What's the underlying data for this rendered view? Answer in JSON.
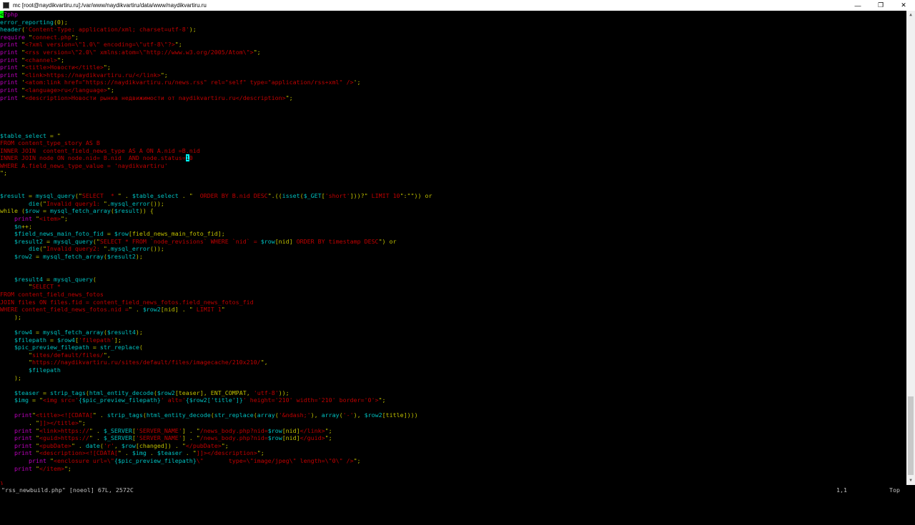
{
  "window": {
    "title": "mc [root@naydikvartiru.ru]:/var/www/naydikvartiru/data/www/naydikvartiru.ru",
    "minimize": "—",
    "maximize": "❐",
    "close": "✕"
  },
  "colors": {
    "default": "#c0c0c0",
    "variable": "#00c0c0",
    "string": "#c00000",
    "keyword": "#c0c000",
    "function": "#00c0c0",
    "magenta": "#c000c0"
  },
  "code": [
    [
      {
        "t": "<",
        "c": "cursor"
      },
      {
        "t": "?php",
        "c": "magenta"
      }
    ],
    [
      {
        "t": "error_reporting",
        "c": "function"
      },
      {
        "t": "(0);",
        "c": "keyword"
      }
    ],
    [
      {
        "t": "header",
        "c": "function"
      },
      {
        "t": "(",
        "c": "keyword"
      },
      {
        "t": "'Content-Type: application/xml; charset=utf-8'",
        "c": "string"
      },
      {
        "t": ");",
        "c": "keyword"
      }
    ],
    [
      {
        "t": "require",
        "c": "magenta"
      },
      {
        "t": " \"",
        "c": "keyword"
      },
      {
        "t": "connect.php",
        "c": "string"
      },
      {
        "t": "\";",
        "c": "keyword"
      }
    ],
    [
      {
        "t": "print",
        "c": "magenta"
      },
      {
        "t": " \"",
        "c": "keyword"
      },
      {
        "t": "<?xml version=\\\"1.0\\\" encoding=\\\"utf-8\\\"?>",
        "c": "string"
      },
      {
        "t": "\";",
        "c": "keyword"
      }
    ],
    [
      {
        "t": "print",
        "c": "magenta"
      },
      {
        "t": " \"",
        "c": "keyword"
      },
      {
        "t": "<rss version=\\\"2.0\\\" xmlns:atom=\\\"http://www.w3.org/2005/Atom\\\">",
        "c": "string"
      },
      {
        "t": "\";",
        "c": "keyword"
      }
    ],
    [
      {
        "t": "print",
        "c": "magenta"
      },
      {
        "t": " \"",
        "c": "keyword"
      },
      {
        "t": "<channel>",
        "c": "string"
      },
      {
        "t": "\";",
        "c": "keyword"
      }
    ],
    [
      {
        "t": "print",
        "c": "magenta"
      },
      {
        "t": " \"",
        "c": "keyword"
      },
      {
        "t": "<title>Новости</title>",
        "c": "string"
      },
      {
        "t": "\";",
        "c": "keyword"
      }
    ],
    [
      {
        "t": "print",
        "c": "magenta"
      },
      {
        "t": " \"",
        "c": "keyword"
      },
      {
        "t": "<link>https://naydikvartiru.ru/</link>",
        "c": "string"
      },
      {
        "t": "\";",
        "c": "keyword"
      }
    ],
    [
      {
        "t": "print",
        "c": "magenta"
      },
      {
        "t": " '",
        "c": "keyword"
      },
      {
        "t": "<atom:link href=\"https://naydikvartiru.ru/news.rss\" rel=\"self\" type=\"application/rss+xml\" />",
        "c": "string"
      },
      {
        "t": "';",
        "c": "keyword"
      }
    ],
    [
      {
        "t": "print",
        "c": "magenta"
      },
      {
        "t": " \"",
        "c": "keyword"
      },
      {
        "t": "<language>ru</language>",
        "c": "string"
      },
      {
        "t": "\";",
        "c": "keyword"
      }
    ],
    [
      {
        "t": "print",
        "c": "magenta"
      },
      {
        "t": " \"",
        "c": "keyword"
      },
      {
        "t": "<description>Новости рынка недвижимости от naydikvartiru.ru</description>",
        "c": "string"
      },
      {
        "t": "\";",
        "c": "keyword"
      }
    ],
    [],
    [],
    [],
    [],
    [
      {
        "t": "$table_select",
        "c": "variable"
      },
      {
        "t": " = \"",
        "c": "keyword"
      }
    ],
    [
      {
        "t": "FROM content_type_story AS B",
        "c": "string"
      }
    ],
    [
      {
        "t": "INNER JOIN  content_field_news_type AS A ON A.nid =B.nid",
        "c": "string"
      }
    ],
    [
      {
        "t": "INNER JOIN node ON node.nid= B.nid  AND node.status=",
        "c": "string"
      },
      {
        "t": "1",
        "c": "cursor2"
      },
      {
        "t": "0",
        "c": "string"
      }
    ],
    [
      {
        "t": "WHERE A.field_news_type_value = 'naydikvartiru'",
        "c": "string"
      }
    ],
    [
      {
        "t": "\";",
        "c": "keyword"
      }
    ],
    [],
    [],
    [
      {
        "t": "$result",
        "c": "variable"
      },
      {
        "t": " = ",
        "c": "keyword"
      },
      {
        "t": "mysql_query",
        "c": "function"
      },
      {
        "t": "(\"",
        "c": "keyword"
      },
      {
        "t": "SELECT  * ",
        "c": "string"
      },
      {
        "t": "\" . ",
        "c": "keyword"
      },
      {
        "t": "$table_select",
        "c": "variable"
      },
      {
        "t": " . \"",
        "c": "keyword"
      },
      {
        "t": "  ORDER BY B.nid DESC",
        "c": "string"
      },
      {
        "t": "\".((",
        "c": "keyword"
      },
      {
        "t": "isset",
        "c": "function"
      },
      {
        "t": "(",
        "c": "keyword"
      },
      {
        "t": "$_GET",
        "c": "variable"
      },
      {
        "t": "[",
        "c": "keyword"
      },
      {
        "t": "'short'",
        "c": "string"
      },
      {
        "t": "]))?\" ",
        "c": "keyword"
      },
      {
        "t": "LIMIT 10",
        "c": "string"
      },
      {
        "t": "\":\"\")) or",
        "c": "keyword"
      }
    ],
    [
      {
        "t": "        ",
        "c": "keyword"
      },
      {
        "t": "die",
        "c": "function"
      },
      {
        "t": "(\"",
        "c": "keyword"
      },
      {
        "t": "Invalid query1: ",
        "c": "string"
      },
      {
        "t": "\".",
        "c": "keyword"
      },
      {
        "t": "mysql_error",
        "c": "function"
      },
      {
        "t": "());",
        "c": "keyword"
      }
    ],
    [
      {
        "t": "while",
        "c": "keyword"
      },
      {
        "t": " (",
        "c": "keyword"
      },
      {
        "t": "$row",
        "c": "variable"
      },
      {
        "t": " = ",
        "c": "keyword"
      },
      {
        "t": "mysql_fetch_array",
        "c": "function"
      },
      {
        "t": "(",
        "c": "keyword"
      },
      {
        "t": "$result",
        "c": "variable"
      },
      {
        "t": ")) {",
        "c": "keyword"
      }
    ],
    [
      {
        "t": "    ",
        "c": "keyword"
      },
      {
        "t": "print",
        "c": "magenta"
      },
      {
        "t": " \"",
        "c": "keyword"
      },
      {
        "t": "<item>",
        "c": "string"
      },
      {
        "t": "\";",
        "c": "keyword"
      }
    ],
    [
      {
        "t": "    ",
        "c": "keyword"
      },
      {
        "t": "$n",
        "c": "variable"
      },
      {
        "t": "++;",
        "c": "keyword"
      }
    ],
    [
      {
        "t": "    ",
        "c": "keyword"
      },
      {
        "t": "$field_news_main_foto_fid",
        "c": "variable"
      },
      {
        "t": " = ",
        "c": "keyword"
      },
      {
        "t": "$row",
        "c": "variable"
      },
      {
        "t": "[field_news_main_foto_fid];",
        "c": "keyword"
      }
    ],
    [
      {
        "t": "    ",
        "c": "keyword"
      },
      {
        "t": "$result2",
        "c": "variable"
      },
      {
        "t": " = ",
        "c": "keyword"
      },
      {
        "t": "mysql_query",
        "c": "function"
      },
      {
        "t": "(\"",
        "c": "keyword"
      },
      {
        "t": "SELECT * FROM `node_revisions` WHERE `nid` = ",
        "c": "string"
      },
      {
        "t": "$row",
        "c": "variable"
      },
      {
        "t": "[nid]",
        "c": "keyword"
      },
      {
        "t": " ORDER BY timestamp DESC",
        "c": "string"
      },
      {
        "t": "\") or",
        "c": "keyword"
      }
    ],
    [
      {
        "t": "        ",
        "c": "keyword"
      },
      {
        "t": "die",
        "c": "function"
      },
      {
        "t": "(\"",
        "c": "keyword"
      },
      {
        "t": "Invalid query2: ",
        "c": "string"
      },
      {
        "t": "\".",
        "c": "keyword"
      },
      {
        "t": "mysql_error",
        "c": "function"
      },
      {
        "t": "());",
        "c": "keyword"
      }
    ],
    [
      {
        "t": "    ",
        "c": "keyword"
      },
      {
        "t": "$row2",
        "c": "variable"
      },
      {
        "t": " = ",
        "c": "keyword"
      },
      {
        "t": "mysql_fetch_array",
        "c": "function"
      },
      {
        "t": "(",
        "c": "keyword"
      },
      {
        "t": "$result2",
        "c": "variable"
      },
      {
        "t": ");",
        "c": "keyword"
      }
    ],
    [],
    [],
    [
      {
        "t": "    ",
        "c": "keyword"
      },
      {
        "t": "$result4",
        "c": "variable"
      },
      {
        "t": " = ",
        "c": "keyword"
      },
      {
        "t": "mysql_query",
        "c": "function"
      },
      {
        "t": "(",
        "c": "keyword"
      }
    ],
    [
      {
        "t": "        \"",
        "c": "keyword"
      },
      {
        "t": "SELECT *",
        "c": "string"
      }
    ],
    [
      {
        "t": "FROM content_field_news_fotos",
        "c": "string"
      }
    ],
    [
      {
        "t": "JOIN files ON files.fid = content_field_news_fotos.field_news_fotos_fid",
        "c": "string"
      }
    ],
    [
      {
        "t": "WHERE content_field_news_fotos.nid =",
        "c": "string"
      },
      {
        "t": "\" . ",
        "c": "keyword"
      },
      {
        "t": "$row2",
        "c": "variable"
      },
      {
        "t": "[nid] . \"",
        "c": "keyword"
      },
      {
        "t": " LIMIT 1",
        "c": "string"
      },
      {
        "t": "\"",
        "c": "keyword"
      }
    ],
    [
      {
        "t": "    );",
        "c": "keyword"
      }
    ],
    [],
    [
      {
        "t": "    ",
        "c": "keyword"
      },
      {
        "t": "$row4",
        "c": "variable"
      },
      {
        "t": " = ",
        "c": "keyword"
      },
      {
        "t": "mysql_fetch_array",
        "c": "function"
      },
      {
        "t": "(",
        "c": "keyword"
      },
      {
        "t": "$result4",
        "c": "variable"
      },
      {
        "t": ");",
        "c": "keyword"
      }
    ],
    [
      {
        "t": "    ",
        "c": "keyword"
      },
      {
        "t": "$filepath",
        "c": "variable"
      },
      {
        "t": " = ",
        "c": "keyword"
      },
      {
        "t": "$row4",
        "c": "variable"
      },
      {
        "t": "[",
        "c": "keyword"
      },
      {
        "t": "'filepath'",
        "c": "string"
      },
      {
        "t": "];",
        "c": "keyword"
      }
    ],
    [
      {
        "t": "    ",
        "c": "keyword"
      },
      {
        "t": "$pic_preview_filepath",
        "c": "variable"
      },
      {
        "t": " = ",
        "c": "keyword"
      },
      {
        "t": "str_replace",
        "c": "function"
      },
      {
        "t": "(",
        "c": "keyword"
      }
    ],
    [
      {
        "t": "        \"",
        "c": "keyword"
      },
      {
        "t": "sites/default/files/",
        "c": "string"
      },
      {
        "t": "\",",
        "c": "keyword"
      }
    ],
    [
      {
        "t": "        \"",
        "c": "keyword"
      },
      {
        "t": "https://naydikvartiru.ru/sites/default/files/imagecache/210x210/",
        "c": "string"
      },
      {
        "t": "\",",
        "c": "keyword"
      }
    ],
    [
      {
        "t": "        ",
        "c": "keyword"
      },
      {
        "t": "$filepath",
        "c": "variable"
      }
    ],
    [
      {
        "t": "    );",
        "c": "keyword"
      }
    ],
    [],
    [
      {
        "t": "    ",
        "c": "keyword"
      },
      {
        "t": "$teaser",
        "c": "variable"
      },
      {
        "t": " = ",
        "c": "keyword"
      },
      {
        "t": "strip_tags",
        "c": "function"
      },
      {
        "t": "(",
        "c": "keyword"
      },
      {
        "t": "html_entity_decode",
        "c": "function"
      },
      {
        "t": "(",
        "c": "keyword"
      },
      {
        "t": "$row2",
        "c": "variable"
      },
      {
        "t": "[teaser], ENT_COMPAT, ",
        "c": "keyword"
      },
      {
        "t": "'utf-8'",
        "c": "string"
      },
      {
        "t": "));",
        "c": "keyword"
      }
    ],
    [
      {
        "t": "    ",
        "c": "keyword"
      },
      {
        "t": "$img",
        "c": "variable"
      },
      {
        "t": " = \"",
        "c": "keyword"
      },
      {
        "t": "<img src='",
        "c": "string"
      },
      {
        "t": "{$pic_preview_filepath}",
        "c": "variable"
      },
      {
        "t": "' alt='",
        "c": "string"
      },
      {
        "t": "{$row2['title']}",
        "c": "variable"
      },
      {
        "t": "' height='210' width='210' border='0'>",
        "c": "string"
      },
      {
        "t": "\";",
        "c": "keyword"
      }
    ],
    [],
    [
      {
        "t": "    ",
        "c": "keyword"
      },
      {
        "t": "print",
        "c": "magenta"
      },
      {
        "t": "\"",
        "c": "keyword"
      },
      {
        "t": "<title><![CDATA[",
        "c": "string"
      },
      {
        "t": "\" . ",
        "c": "keyword"
      },
      {
        "t": "strip_tags",
        "c": "function"
      },
      {
        "t": "(",
        "c": "keyword"
      },
      {
        "t": "html_entity_decode",
        "c": "function"
      },
      {
        "t": "(",
        "c": "keyword"
      },
      {
        "t": "str_replace",
        "c": "function"
      },
      {
        "t": "(",
        "c": "keyword"
      },
      {
        "t": "array",
        "c": "function"
      },
      {
        "t": "(",
        "c": "keyword"
      },
      {
        "t": "'&ndash;'",
        "c": "string"
      },
      {
        "t": "), ",
        "c": "keyword"
      },
      {
        "t": "array",
        "c": "function"
      },
      {
        "t": "(",
        "c": "keyword"
      },
      {
        "t": "'-'",
        "c": "string"
      },
      {
        "t": "), ",
        "c": "keyword"
      },
      {
        "t": "$row2",
        "c": "variable"
      },
      {
        "t": "[title])))",
        "c": "keyword"
      }
    ],
    [
      {
        "t": "        . \"",
        "c": "keyword"
      },
      {
        "t": "]]></title>",
        "c": "string"
      },
      {
        "t": "\";",
        "c": "keyword"
      }
    ],
    [
      {
        "t": "    ",
        "c": "keyword"
      },
      {
        "t": "print",
        "c": "magenta"
      },
      {
        "t": " \"",
        "c": "keyword"
      },
      {
        "t": "<link>https://",
        "c": "string"
      },
      {
        "t": "\" . ",
        "c": "keyword"
      },
      {
        "t": "$_SERVER",
        "c": "variable"
      },
      {
        "t": "[",
        "c": "keyword"
      },
      {
        "t": "'SERVER_NAME'",
        "c": "string"
      },
      {
        "t": "] . \"",
        "c": "keyword"
      },
      {
        "t": "/news_body.php?nid=",
        "c": "string"
      },
      {
        "t": "$row",
        "c": "variable"
      },
      {
        "t": "[nid]",
        "c": "keyword"
      },
      {
        "t": "</link>",
        "c": "string"
      },
      {
        "t": "\";",
        "c": "keyword"
      }
    ],
    [
      {
        "t": "    ",
        "c": "keyword"
      },
      {
        "t": "print",
        "c": "magenta"
      },
      {
        "t": " \"",
        "c": "keyword"
      },
      {
        "t": "<guid>https://",
        "c": "string"
      },
      {
        "t": "\" . ",
        "c": "keyword"
      },
      {
        "t": "$_SERVER",
        "c": "variable"
      },
      {
        "t": "[",
        "c": "keyword"
      },
      {
        "t": "'SERVER_NAME'",
        "c": "string"
      },
      {
        "t": "] . \"",
        "c": "keyword"
      },
      {
        "t": "/news_body.php?nid=",
        "c": "string"
      },
      {
        "t": "$row",
        "c": "variable"
      },
      {
        "t": "[nid]",
        "c": "keyword"
      },
      {
        "t": "</guid>",
        "c": "string"
      },
      {
        "t": "\";",
        "c": "keyword"
      }
    ],
    [
      {
        "t": "    ",
        "c": "keyword"
      },
      {
        "t": "print",
        "c": "magenta"
      },
      {
        "t": " \"",
        "c": "keyword"
      },
      {
        "t": "<pubDate>",
        "c": "string"
      },
      {
        "t": "\" . ",
        "c": "keyword"
      },
      {
        "t": "date",
        "c": "function"
      },
      {
        "t": "(",
        "c": "keyword"
      },
      {
        "t": "'r'",
        "c": "string"
      },
      {
        "t": ", ",
        "c": "keyword"
      },
      {
        "t": "$row",
        "c": "variable"
      },
      {
        "t": "[changed]) . \"",
        "c": "keyword"
      },
      {
        "t": "</pubDate>",
        "c": "string"
      },
      {
        "t": "\";",
        "c": "keyword"
      }
    ],
    [
      {
        "t": "    ",
        "c": "keyword"
      },
      {
        "t": "print",
        "c": "magenta"
      },
      {
        "t": " \"",
        "c": "keyword"
      },
      {
        "t": "<description><![CDATA[",
        "c": "string"
      },
      {
        "t": "\" . ",
        "c": "keyword"
      },
      {
        "t": "$img",
        "c": "variable"
      },
      {
        "t": " . ",
        "c": "keyword"
      },
      {
        "t": "$teaser",
        "c": "variable"
      },
      {
        "t": " . \"",
        "c": "keyword"
      },
      {
        "t": "]]></description>",
        "c": "string"
      },
      {
        "t": "\";",
        "c": "keyword"
      }
    ],
    [
      {
        "t": "        ",
        "c": "keyword"
      },
      {
        "t": "print",
        "c": "magenta"
      },
      {
        "t": " \"",
        "c": "keyword"
      },
      {
        "t": "<enclosure url=\\\"",
        "c": "string"
      },
      {
        "t": "{$pic_preview_filepath}",
        "c": "variable"
      },
      {
        "t": "\\\"       type=\\\"image/jpeg\\\" length=\\\"0\\\" />",
        "c": "string"
      },
      {
        "t": "\";",
        "c": "keyword"
      }
    ],
    [
      {
        "t": "    ",
        "c": "keyword"
      },
      {
        "t": "print",
        "c": "magenta"
      },
      {
        "t": " \"",
        "c": "keyword"
      },
      {
        "t": "</item>",
        "c": "string"
      },
      {
        "t": "\";",
        "c": "keyword"
      }
    ],
    [],
    [
      {
        "t": "}",
        "c": "string"
      }
    ]
  ],
  "status": {
    "file_info": "\"rss_newbuild.php\" [noeol] 67L, 2572C",
    "cursor_pos": "1,1",
    "scroll_pos": "Top"
  }
}
